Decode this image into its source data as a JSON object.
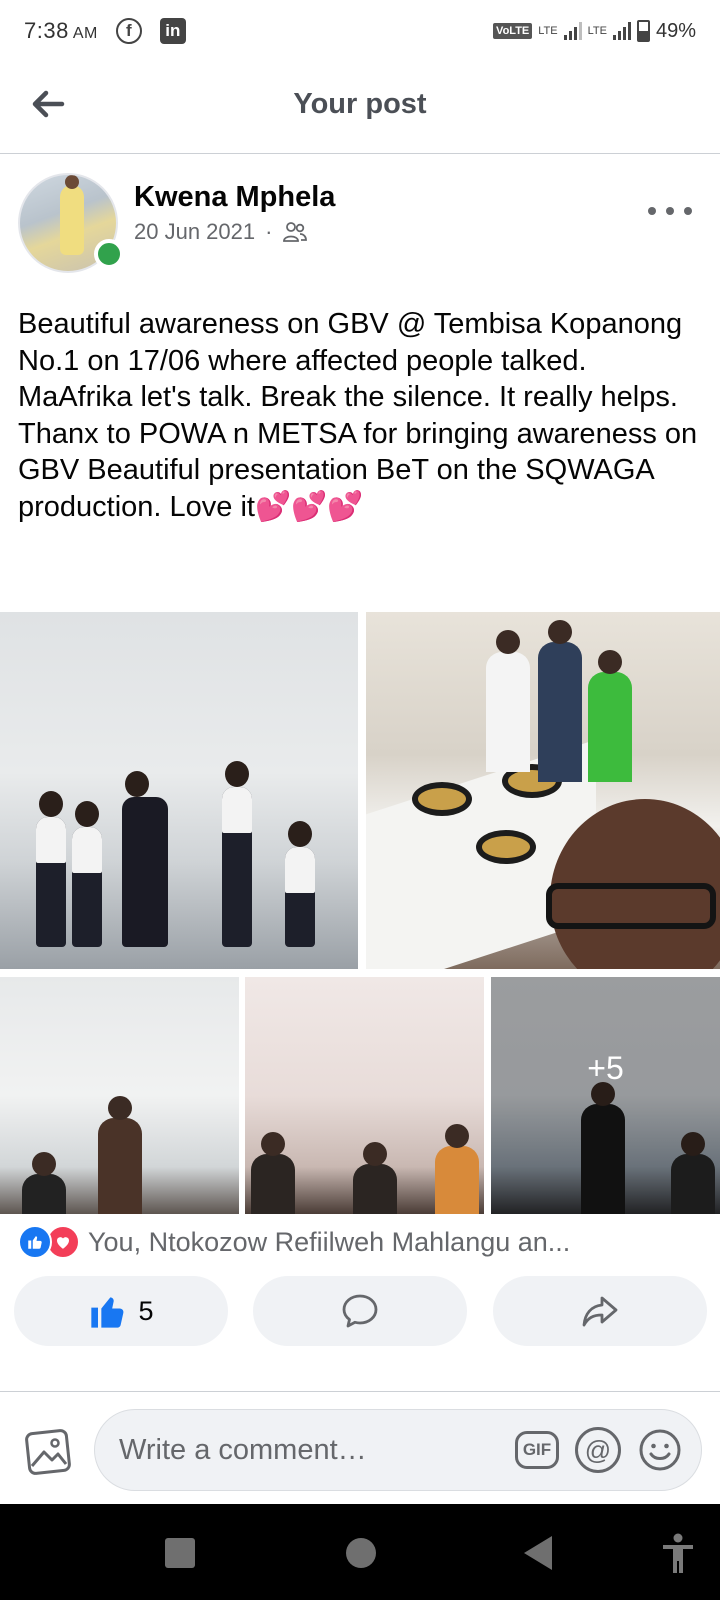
{
  "status_bar": {
    "time": "7:38",
    "ampm": "AM",
    "network_tag": "VoLTE",
    "lte_1": "LTE",
    "lte_2": "LTE",
    "battery": "49%"
  },
  "header": {
    "title": "Your post"
  },
  "post": {
    "author": "Kwena Mphela",
    "date": "20 Jun 2021",
    "separator": "·",
    "audience_icon": "friends-icon",
    "text": "Beautiful awareness on GBV @ Tembisa Kopanong No.1 on 17/06 where affected people talked. MaAfrika let's talk. Break the silence. It really helps. Thanx to POWA n METSA for bringing awareness on GBV Beautiful presentation BeT on the SQWAGA production. Love it",
    "emoji": "💕💕💕",
    "more_photos": "+5"
  },
  "reactions": {
    "summary": "You, Ntokozow Refiilweh Mahlangu an...",
    "like_count": "5"
  },
  "comment_bar": {
    "placeholder": "Write a comment…",
    "gif_label": "GIF",
    "at_label": "@"
  },
  "colors": {
    "accent": "#1877f2",
    "love": "#f33e58",
    "online": "#31a24c",
    "secondary_text": "#65676b"
  }
}
